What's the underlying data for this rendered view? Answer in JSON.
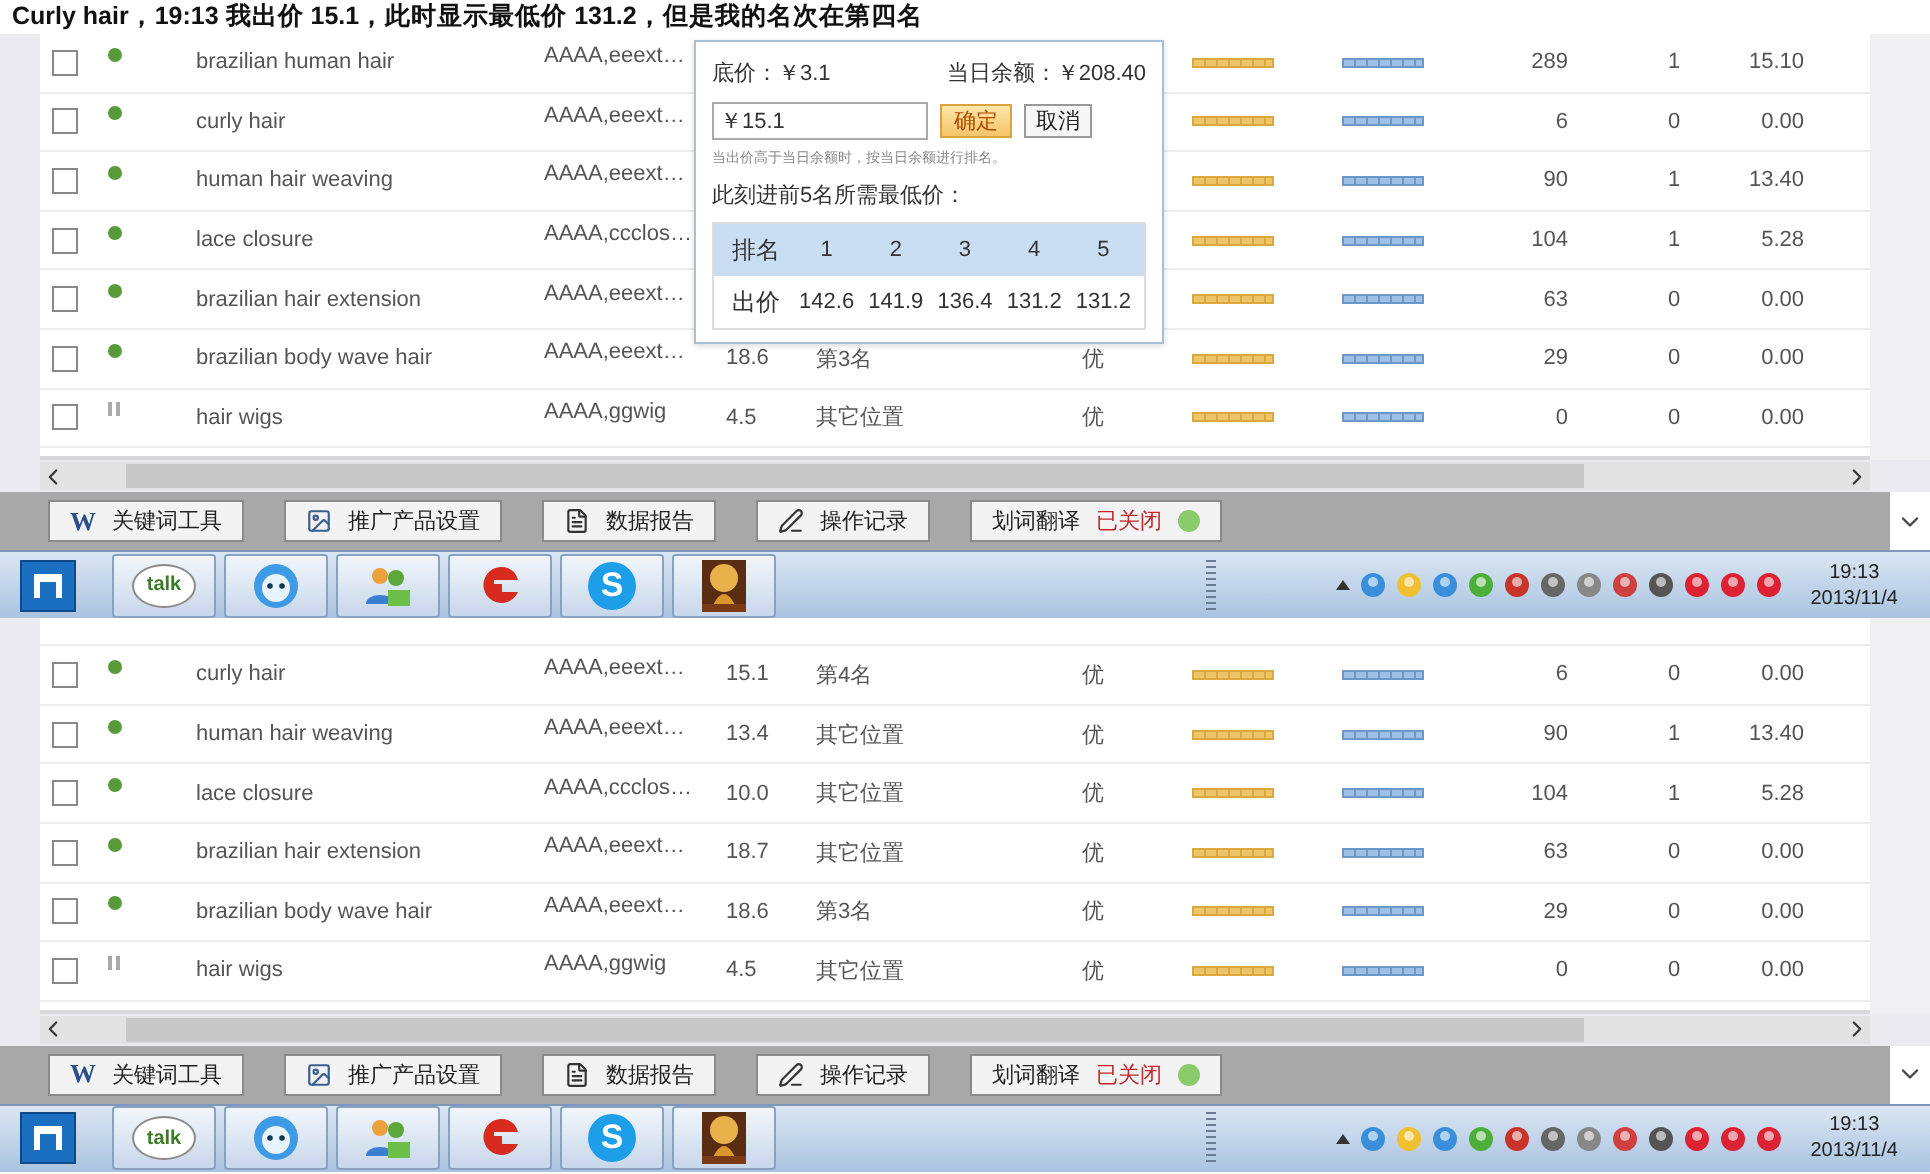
{
  "caption": "Curly hair，19:13 我出价 15.1，此时显示最低价 131.2，但是我的名次在第四名",
  "shots": [
    {
      "rows": [
        {
          "checked": false,
          "paused": false,
          "keyword": "brazilian human hair",
          "product": "AAAA,eeext…",
          "impressions": "289",
          "clicks": "1",
          "cost": "15.10"
        },
        {
          "checked": false,
          "paused": false,
          "keyword": "curly hair",
          "product": "AAAA,eeext…",
          "impressions": "6",
          "clicks": "0",
          "cost": "0.00"
        },
        {
          "checked": false,
          "paused": false,
          "keyword": "human hair weaving",
          "product": "AAAA,eeext…",
          "impressions": "90",
          "clicks": "1",
          "cost": "13.40"
        },
        {
          "checked": false,
          "paused": false,
          "keyword": "lace closure",
          "product": "AAAA,ccclos…",
          "impressions": "104",
          "clicks": "1",
          "cost": "5.28"
        },
        {
          "checked": false,
          "paused": false,
          "keyword": "brazilian hair extension",
          "product": "AAAA,eeext…",
          "impressions": "63",
          "clicks": "0",
          "cost": "0.00"
        },
        {
          "checked": false,
          "paused": false,
          "keyword": "brazilian body wave hair",
          "product": "AAAA,eeext…",
          "bid": "18.6",
          "rank": "第3名",
          "quality": "优",
          "impressions": "29",
          "clicks": "0",
          "cost": "0.00"
        },
        {
          "checked": false,
          "paused": true,
          "keyword": "hair wigs",
          "product": "AAAA,ggwig",
          "bid": "4.5",
          "rank": "其它位置",
          "quality": "优",
          "impressions": "0",
          "clicks": "0",
          "cost": "0.00"
        }
      ],
      "popup": {
        "floor_price": "底价：￥3.1",
        "balance": "当日余额：￥208.40",
        "bid_value": "￥15.1",
        "confirm": "确定",
        "cancel": "取消",
        "hint": "当出价高于当日余额时，按当日余额进行排名。",
        "title": "此刻进前5名所需最低价：",
        "header": [
          "排名",
          "1",
          "2",
          "3",
          "4",
          "5"
        ],
        "prices": [
          "出价",
          "142.6",
          "141.9",
          "136.4",
          "131.2",
          "131.2"
        ]
      },
      "toolbar": {
        "buttons": [
          {
            "kind": "keyword",
            "icon_text": "W",
            "label": "关键词工具"
          },
          {
            "kind": "products",
            "label": "推广产品设置"
          },
          {
            "kind": "report",
            "label": "数据报告"
          },
          {
            "kind": "log",
            "label": "操作记录"
          },
          {
            "kind": "translate",
            "label": "划词翻译",
            "status": "已关闭"
          }
        ]
      },
      "taskbar": {
        "apps": [
          {
            "kind": "start"
          },
          {
            "kind": "talk",
            "label": "talk"
          },
          {
            "kind": "chat"
          },
          {
            "kind": "contacts"
          },
          {
            "kind": "g"
          },
          {
            "kind": "skype",
            "label": "S"
          },
          {
            "kind": "picture"
          }
        ],
        "time": "19:13",
        "date": "2013/11/4"
      }
    },
    {
      "partial_top_row": true,
      "rows": [
        {
          "checked": false,
          "paused": false,
          "keyword": "curly hair",
          "product": "AAAA,eeext…",
          "bid": "15.1",
          "rank": "第4名",
          "quality": "优",
          "impressions": "6",
          "clicks": "0",
          "cost": "0.00"
        },
        {
          "checked": false,
          "paused": false,
          "keyword": "human hair weaving",
          "product": "AAAA,eeext…",
          "bid": "13.4",
          "rank": "其它位置",
          "quality": "优",
          "impressions": "90",
          "clicks": "1",
          "cost": "13.40"
        },
        {
          "checked": false,
          "paused": false,
          "keyword": "lace closure",
          "product": "AAAA,ccclos…",
          "bid": "10.0",
          "rank": "其它位置",
          "quality": "优",
          "impressions": "104",
          "clicks": "1",
          "cost": "5.28"
        },
        {
          "checked": false,
          "paused": false,
          "keyword": "brazilian hair extension",
          "product": "AAAA,eeext…",
          "bid": "18.7",
          "rank": "其它位置",
          "quality": "优",
          "impressions": "63",
          "clicks": "0",
          "cost": "0.00"
        },
        {
          "checked": false,
          "paused": false,
          "keyword": "brazilian body wave hair",
          "product": "AAAA,eeext…",
          "bid": "18.6",
          "rank": "第3名",
          "quality": "优",
          "impressions": "29",
          "clicks": "0",
          "cost": "0.00"
        },
        {
          "checked": false,
          "paused": true,
          "keyword": "hair wigs",
          "product": "AAAA,ggwig",
          "bid": "4.5",
          "rank": "其它位置",
          "quality": "优",
          "impressions": "0",
          "clicks": "0",
          "cost": "0.00"
        }
      ],
      "toolbar": {
        "buttons": [
          {
            "kind": "keyword",
            "icon_text": "W",
            "label": "关键词工具"
          },
          {
            "kind": "products",
            "label": "推广产品设置"
          },
          {
            "kind": "report",
            "label": "数据报告"
          },
          {
            "kind": "log",
            "label": "操作记录"
          },
          {
            "kind": "translate",
            "label": "划词翻译",
            "status": "已关闭"
          }
        ]
      },
      "taskbar": {
        "apps": [
          {
            "kind": "start"
          },
          {
            "kind": "talk",
            "label": "talk"
          },
          {
            "kind": "chat"
          },
          {
            "kind": "contacts"
          },
          {
            "kind": "g"
          },
          {
            "kind": "skype",
            "label": "S"
          },
          {
            "kind": "picture"
          }
        ],
        "time": "19:13",
        "date": "2013/11/4"
      }
    }
  ]
}
